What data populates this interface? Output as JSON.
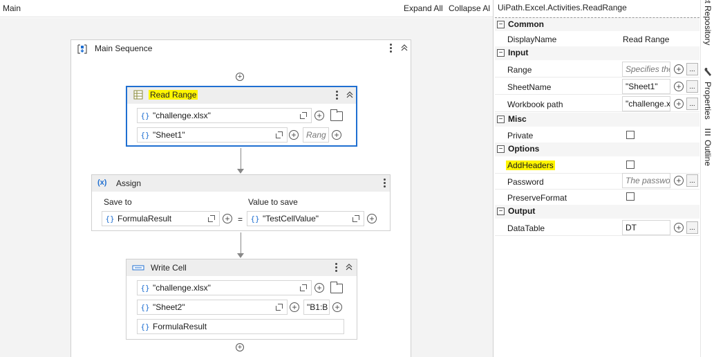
{
  "designer": {
    "tab_title": "Main",
    "expand_all": "Expand All",
    "collapse_all": "Collapse Al"
  },
  "main_sequence": {
    "title": "Main Sequence"
  },
  "read_range": {
    "title": "Read Range",
    "workbook": "\"challenge.xlsx\"",
    "sheet": "\"Sheet1\"",
    "range_placeholder": "Rang"
  },
  "assign": {
    "title": "Assign",
    "save_to_label": "Save to",
    "value_label": "Value to save",
    "save_to_value": "FormulaResult",
    "equals": "=",
    "value": "\"TestCellValue\""
  },
  "write_cell": {
    "title": "Write Cell",
    "workbook": "\"challenge.xlsx\"",
    "sheet": "\"Sheet2\"",
    "cell": "\"B1:B",
    "value": "FormulaResult"
  },
  "icons": {
    "curly": "{}",
    "plus": "+",
    "ellipsis": "..."
  },
  "properties": {
    "title": "UiPath.Excel.Activities.ReadRange",
    "common": {
      "label": "Common",
      "display_name_label": "DisplayName",
      "display_name_value": "Read Range"
    },
    "input": {
      "label": "Input",
      "range_label": "Range",
      "range_placeholder": "Specifies the",
      "sheet_label": "SheetName",
      "sheet_value": "\"Sheet1\"",
      "workbook_label": "Workbook path",
      "workbook_value": "\"challenge.x"
    },
    "misc": {
      "label": "Misc",
      "private_label": "Private"
    },
    "options": {
      "label": "Options",
      "addheaders_label": "AddHeaders",
      "password_label": "Password",
      "password_placeholder": "The passwo",
      "preserve_label": "PreserveFormat"
    },
    "output": {
      "label": "Output",
      "datatable_label": "DataTable",
      "datatable_value": "DT"
    }
  },
  "side_tabs": {
    "repo": "Object Repository",
    "properties": "Properties",
    "outline": "Outline"
  },
  "colors": {
    "selection": "#1f6fd1",
    "highlight": "#fff500"
  }
}
